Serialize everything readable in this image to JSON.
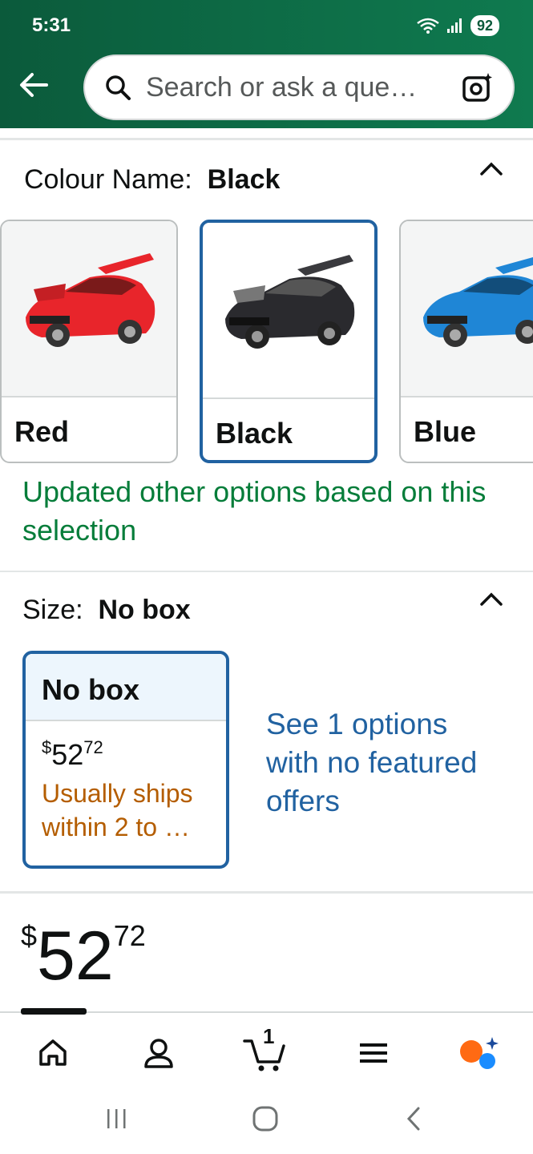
{
  "status_bar": {
    "time": "5:31",
    "battery": "92"
  },
  "search": {
    "placeholder": "Search or ask a que…"
  },
  "colour": {
    "label": "Colour Name:",
    "selected": "Black",
    "swatches": [
      {
        "name": "Red",
        "color": "#e8252b"
      },
      {
        "name": "Black",
        "color": "#2a2a2e"
      },
      {
        "name": "Blue",
        "color": "#1f86d6"
      }
    ],
    "update_message_line1": "Updated other options based on this",
    "update_message_line2": "selection"
  },
  "size": {
    "label": "Size:",
    "selected": "No box",
    "option": {
      "name": "No box",
      "price_symbol": "$",
      "price_whole": "52",
      "price_fraction": "72",
      "shipping": "Usually ships within 2 to …"
    },
    "see_options_text": "See 1 options with no featured offers"
  },
  "price": {
    "symbol": "$",
    "whole": "52",
    "fraction": "72"
  },
  "bottom_nav": {
    "cart_count": "1",
    "items": [
      "home-icon",
      "account-icon",
      "cart-icon",
      "menu-icon",
      "rufus-icon"
    ]
  },
  "colors": {
    "header_green": "#0d6a45",
    "link_blue": "#2162a1",
    "success_green": "#067d3a",
    "ship_orange": "#b45d00"
  }
}
